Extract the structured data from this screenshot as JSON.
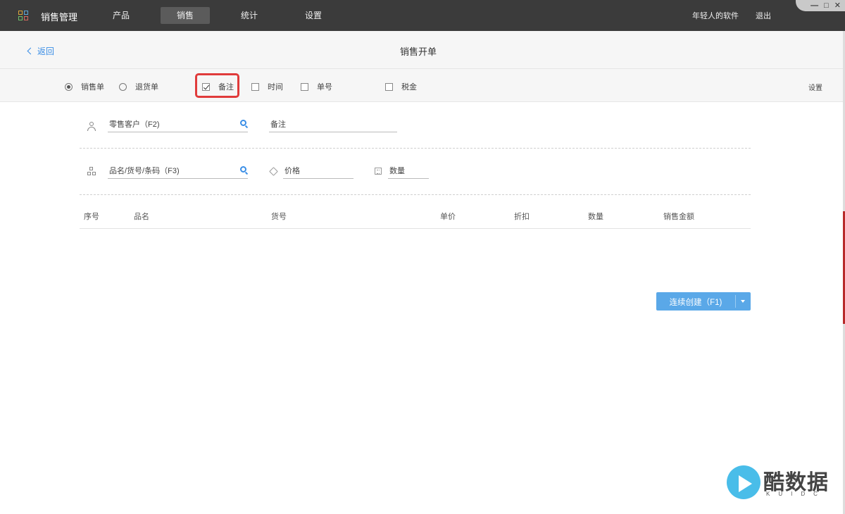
{
  "app": {
    "title": "销售管理",
    "nav_tabs": [
      {
        "label": "产品",
        "active": false
      },
      {
        "label": "销售",
        "active": true
      },
      {
        "label": "统计",
        "active": false
      },
      {
        "label": "设置",
        "active": false
      }
    ],
    "user_label": "年轻人的软件",
    "logout_label": "退出",
    "window_controls": [
      "—",
      "□",
      "✕"
    ]
  },
  "header": {
    "back_label": "返回",
    "page_title": "销售开单"
  },
  "options": {
    "order_types": [
      {
        "label": "销售单",
        "selected": true
      },
      {
        "label": "退货单",
        "selected": false
      }
    ],
    "fields": [
      {
        "label": "备注",
        "checked": true,
        "highlighted": true
      },
      {
        "label": "时间",
        "checked": false
      },
      {
        "label": "单号",
        "checked": false
      },
      {
        "label": "税金",
        "checked": false
      }
    ],
    "settings_label": "设置"
  },
  "form": {
    "customer_placeholder": "零售客户（F2)",
    "remark_placeholder": "备注",
    "product_placeholder": "品名/货号/条码（F3)",
    "price_placeholder": "价格",
    "quantity_placeholder": "数量"
  },
  "table": {
    "columns": [
      "序号",
      "品名",
      "货号",
      "单价",
      "折扣",
      "数量",
      "销售金额"
    ],
    "rows": []
  },
  "actions": {
    "create_label": "连续创建（F1)"
  },
  "watermark": {
    "text": "酷数据",
    "sub": "KUIDC"
  },
  "colors": {
    "topbar": "#3b3b3b",
    "accent": "#3a8ee6",
    "button": "#5aa8e8",
    "highlight_border": "#e03b3b"
  }
}
